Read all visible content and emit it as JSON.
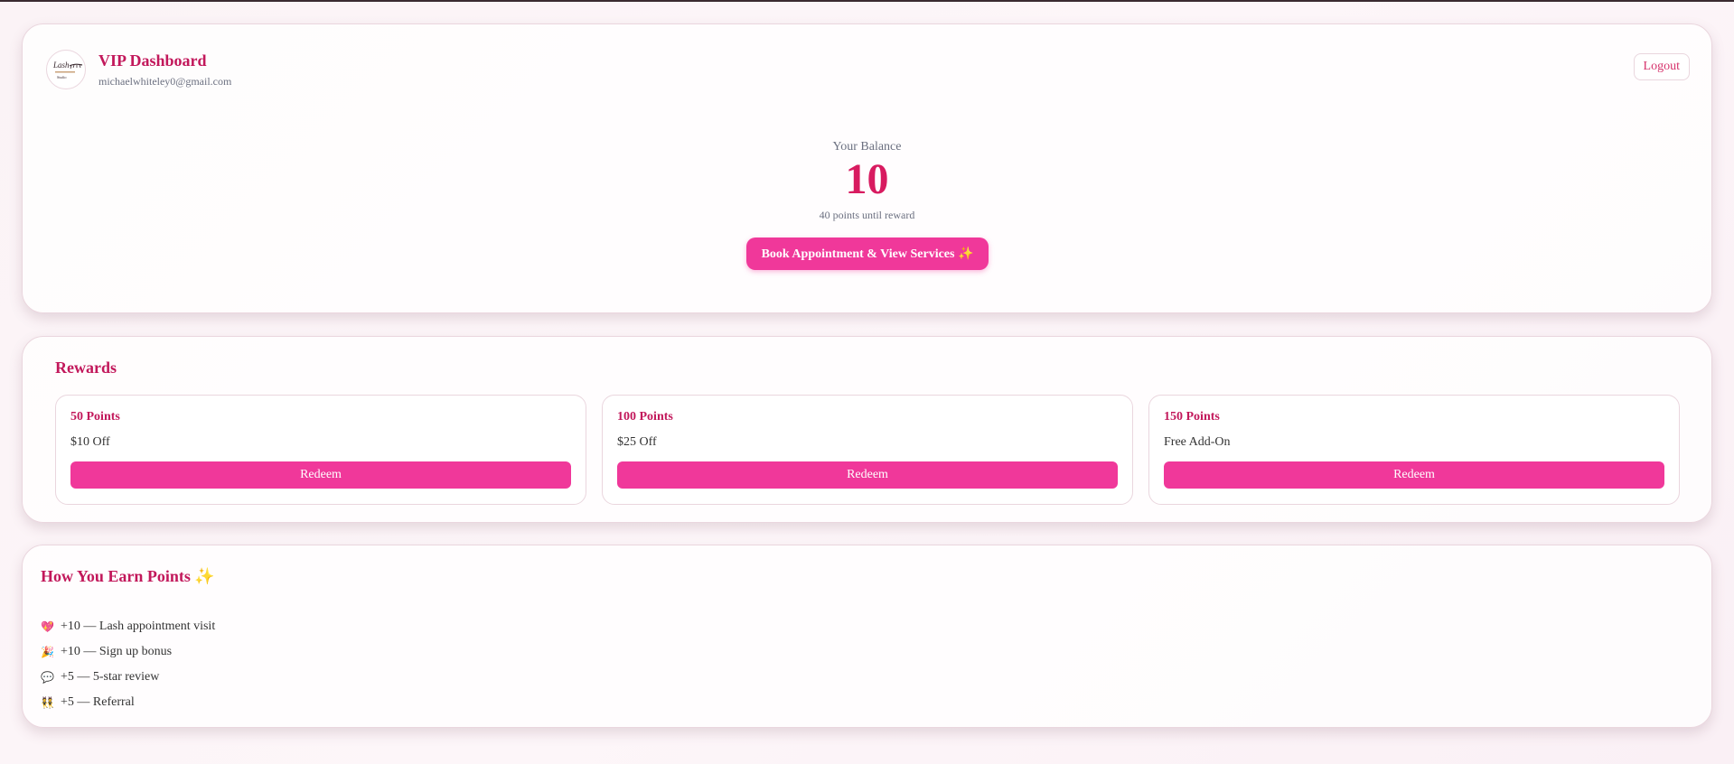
{
  "header": {
    "title": "VIP Dashboard",
    "email": "michaelwhiteley0@gmail.com",
    "logo_text": "Lash",
    "logout_label": "Logout"
  },
  "balance": {
    "label": "Your Balance",
    "value": "10",
    "subtext": "40 points until reward",
    "book_button": "Book Appointment & View Services ✨"
  },
  "rewards": {
    "title": "Rewards",
    "items": [
      {
        "points": "50 Points",
        "description": "$10 Off",
        "button": "Redeem"
      },
      {
        "points": "100 Points",
        "description": "$25 Off",
        "button": "Redeem"
      },
      {
        "points": "150 Points",
        "description": "Free Add-On",
        "button": "Redeem"
      }
    ]
  },
  "earn": {
    "title": "How You Earn Points ✨",
    "items": [
      {
        "icon": "💖",
        "text": "+10 — Lash appointment visit"
      },
      {
        "icon": "🎉",
        "text": "+10 — Sign up bonus"
      },
      {
        "icon": "💬",
        "text": "+5 — 5-star review"
      },
      {
        "icon": "👯",
        "text": "+5 — Referral"
      }
    ]
  },
  "colors": {
    "accent": "#f0389a",
    "heading": "#c2185b",
    "balance": "#d81b60"
  }
}
